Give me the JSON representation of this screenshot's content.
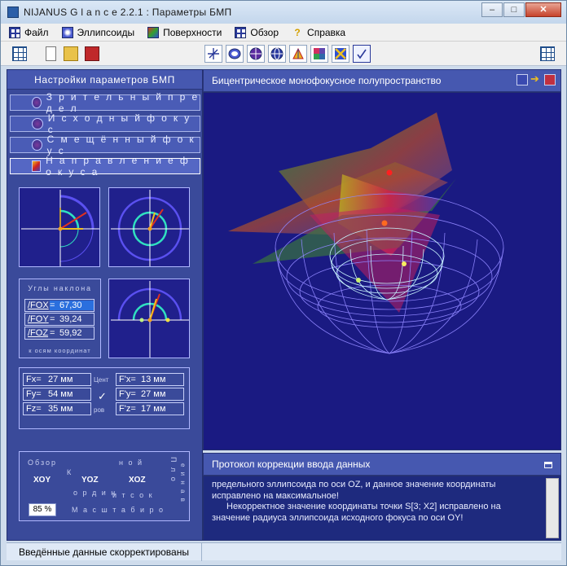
{
  "window": {
    "title": "NIJANUS G l a n c e  2.2.1 :  Параметры  БМП",
    "buttons": {
      "minimize": "–",
      "maximize": "□",
      "close": "✕"
    }
  },
  "menu": [
    {
      "label": "Файл",
      "icon": "grid-icon"
    },
    {
      "label": "Эллипсоиды",
      "icon": "ellipsoid-icon"
    },
    {
      "label": "Поверхности",
      "icon": "surface-icon"
    },
    {
      "label": "Обзор",
      "icon": "view-icon"
    },
    {
      "label": "Справка",
      "icon": "help-icon"
    }
  ],
  "left": {
    "header": "Настройки  параметров  БМП",
    "buttons": [
      {
        "label": "З р и т е л ь н ы й  п р е д е л"
      },
      {
        "label": "И с х о д н ы й     ф о к у с"
      },
      {
        "label": "С м е щ ё н н ы й     ф о к у с"
      },
      {
        "label": "Н а п р а в л е н и е  ф о к у с а"
      }
    ],
    "angles": {
      "title": "Углы наклона",
      "rows": [
        {
          "name": "/FOX",
          "value": "67,30"
        },
        {
          "name": "/FOY",
          "value": "39,24"
        },
        {
          "name": "/FOZ",
          "value": "59,92"
        }
      ],
      "footer": "к осям координат"
    },
    "coords": {
      "left": [
        {
          "k": "Fx=",
          "v": "27 мм"
        },
        {
          "k": "Fy=",
          "v": "54 мм"
        },
        {
          "k": "Fz=",
          "v": "35 мм"
        }
      ],
      "right": [
        {
          "k": "F'x=",
          "v": "13 мм"
        },
        {
          "k": "F'y=",
          "v": "27 мм"
        },
        {
          "k": "F'z=",
          "v": "17 мм"
        }
      ],
      "centr_top": "Цент",
      "centr_bottom": "ров"
    },
    "overview": {
      "obzor": "Обзор",
      "xoy": "XOY",
      "yoz": "YOZ",
      "xoz": "XOZ",
      "koord": "К",
      "ordin": "о р д и н",
      "nat": "н о й",
      "tchok": "и т с о к",
      "plosk": "П л о",
      "nats": "е и н а в",
      "zoom": "85 %",
      "masshtab": "М а с ш т а б и р о"
    }
  },
  "view": {
    "title": "Бицентрическое  монофокусное  полупространство"
  },
  "log": {
    "title": "Протокол  коррекции  ввода  данных",
    "lines": [
      "предельного эллипсоида по оси OZ, и данное значение координаты исправлено на максимальное!",
      "Некорректное значение координаты точки S[3; X2] исправлено на значение радиуса эллипсоида исходного фокуса по оси OY!"
    ]
  },
  "status": {
    "text": "Введённые данные скорректированы"
  }
}
